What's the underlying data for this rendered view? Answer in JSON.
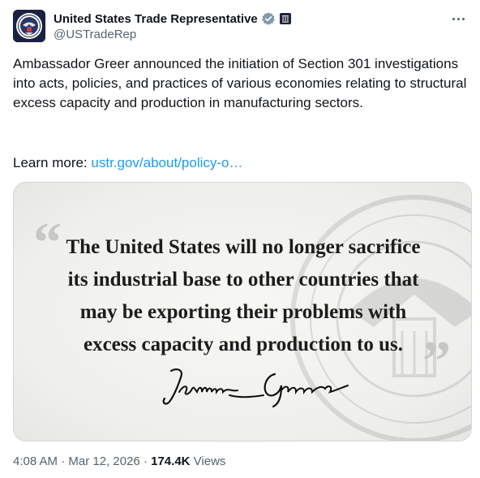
{
  "account": {
    "display_name": "United States Trade Representative",
    "handle": "@USTradeRep",
    "verified_badge_icon": "gray-verified-checkmark-icon",
    "affiliation_icon": "government-building-badge-icon",
    "avatar_icon": "ustr-seal-avatar",
    "more_icon": "more-options-icon"
  },
  "post": {
    "text": "Ambassador Greer announced the initiation of Section 301 investigations into acts, policies, and practices of various economies relating to structural excess capacity and production in manufacturing sectors.",
    "learn_more_label": "Learn more: ",
    "link_text": "ustr.gov/about/policy-o…"
  },
  "media": {
    "quote_open": "“",
    "quote_close": "”",
    "quote_lines": [
      "The United States will no longer sacrifice",
      "its industrial base to other countries that",
      "may be exporting their problems with",
      "excess capacity and production to us."
    ],
    "signature_name": "Jamieson Greer",
    "watermark_icon": "presidential-seal-watermark"
  },
  "meta": {
    "time": "4:08 AM",
    "date": "Mar 12, 2026",
    "views_count": "174.4K",
    "views_label": "Views",
    "separator": "·"
  },
  "colors": {
    "link": "#1d9bf0",
    "secondary_text": "#536471",
    "primary_text": "#0f1419",
    "border": "#cfd9de"
  }
}
